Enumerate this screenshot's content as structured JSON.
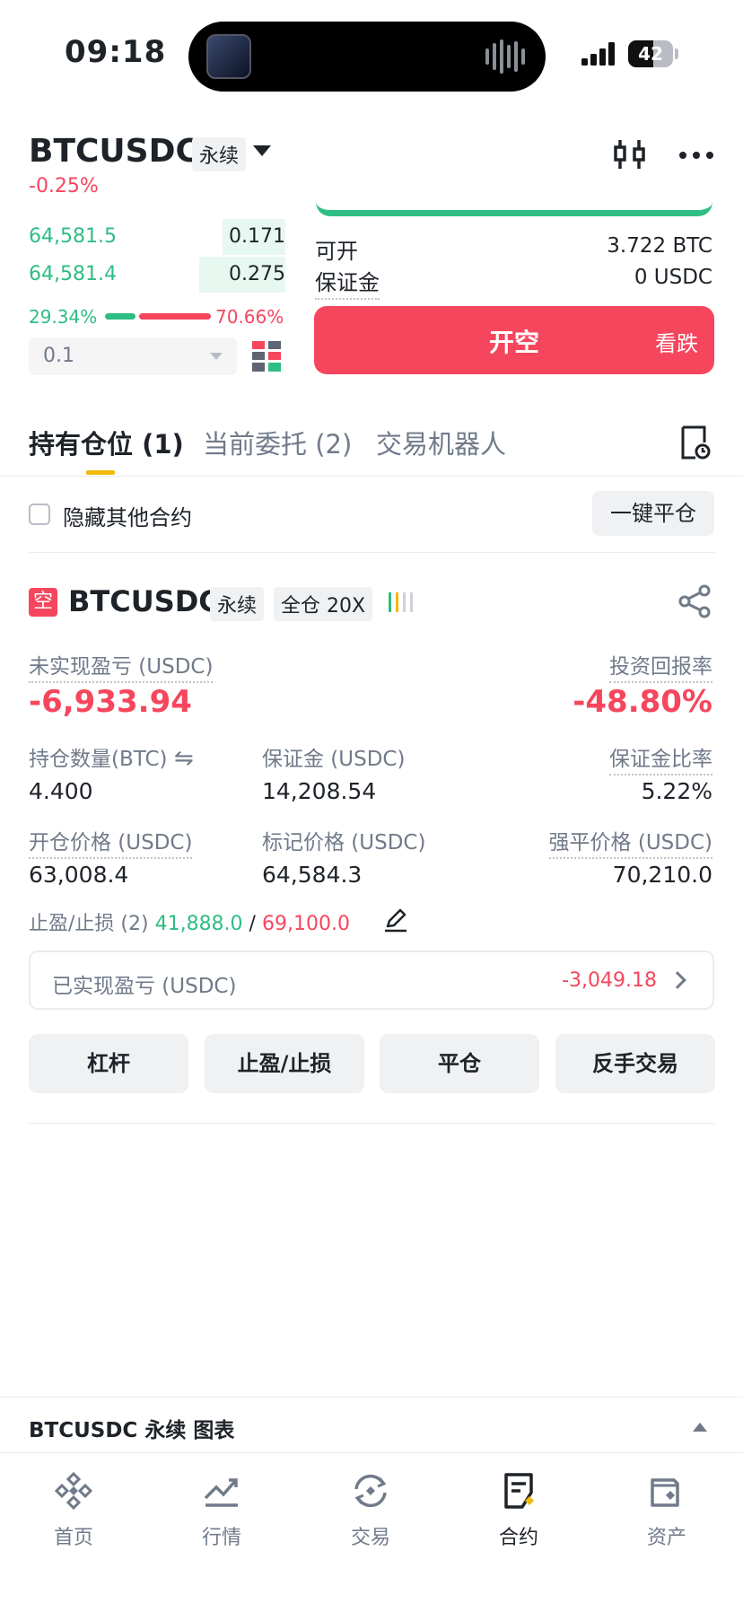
{
  "status_bar": {
    "time": "09:18",
    "battery": "42"
  },
  "header": {
    "symbol": "BTCUSDC",
    "contract_type": "永续",
    "change": "-0.25%"
  },
  "order_book": {
    "rows": [
      {
        "price": "64,581.5",
        "qty": "0.171",
        "depth": 0.25
      },
      {
        "price": "64,581.4",
        "qty": "0.275",
        "depth": 0.4
      }
    ],
    "buy_ratio": "29.34%",
    "sell_ratio": "70.66%",
    "quantity": "0.1"
  },
  "order_panel": {
    "available_label": "可开",
    "available_value": "3.722 BTC",
    "margin_label": "保证金",
    "margin_value": "0 USDC",
    "short_button": "开空",
    "short_sub": "看跌"
  },
  "tabs": [
    "持有仓位 (1)",
    "当前委托 (2)",
    "交易机器人"
  ],
  "hide_other": {
    "label": "隐藏其他合约",
    "close_all": "一键平仓"
  },
  "position": {
    "side": "空",
    "symbol": "BTCUSDC",
    "contract_type": "永续",
    "margin_mode": "全仓 20X",
    "unrealized_label": "未实现盈亏 (USDC)",
    "unrealized_value": "-6,933.94",
    "roe_label": "投资回报率",
    "roe_value": "-48.80%",
    "size_label": "持仓数量(BTC)",
    "size_value": "4.400",
    "margin_label": "保证金 (USDC)",
    "margin_value": "14,208.54",
    "margin_ratio_label": "保证金比率",
    "margin_ratio_value": "5.22%",
    "entry_label": "开仓价格 (USDC)",
    "entry_value": "63,008.4",
    "mark_label": "标记价格 (USDC)",
    "mark_value": "64,584.3",
    "liq_label": "强平价格 (USDC)",
    "liq_value": "70,210.0",
    "tpsl_label": "止盈/止损 (2)",
    "tp_value": "41,888.0",
    "tpsl_sep": "/",
    "sl_value": "69,100.0",
    "realized_label": "已实现盈亏 (USDC)",
    "realized_value": "-3,049.18",
    "actions": [
      "杠杆",
      "止盈/止损",
      "平仓",
      "反手交易"
    ]
  },
  "chart_bar": {
    "label": "BTCUSDC 永续 图表"
  },
  "nav": [
    "首页",
    "行情",
    "交易",
    "合约",
    "资产"
  ],
  "colors": {
    "green": "#2ebd85",
    "red": "#f6465d",
    "accent": "#f0b90b"
  }
}
